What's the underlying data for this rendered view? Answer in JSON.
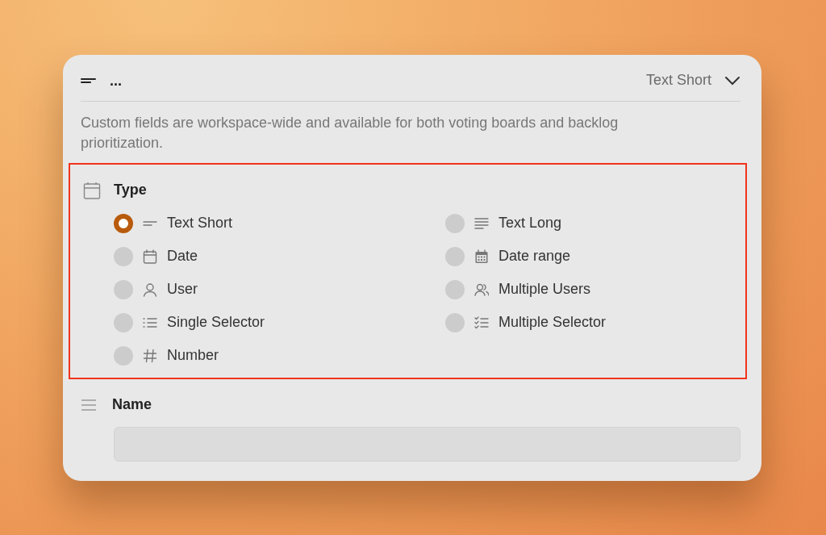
{
  "header": {
    "title": "...",
    "type_select": {
      "value": "Text Short"
    }
  },
  "description": "Custom fields are workspace-wide and available for both voting boards and backlog prioritization.",
  "type_section": {
    "label": "Type",
    "options": [
      {
        "label": "Text Short",
        "kind": "short",
        "selected": true
      },
      {
        "label": "Text Long",
        "kind": "long",
        "selected": false
      },
      {
        "label": "Date",
        "kind": "date",
        "selected": false
      },
      {
        "label": "Date range",
        "kind": "daterange",
        "selected": false
      },
      {
        "label": "User",
        "kind": "user",
        "selected": false
      },
      {
        "label": "Multiple Users",
        "kind": "users",
        "selected": false
      },
      {
        "label": "Single Selector",
        "kind": "list",
        "selected": false
      },
      {
        "label": "Multiple Selector",
        "kind": "checklist",
        "selected": false
      },
      {
        "label": "Number",
        "kind": "number",
        "selected": false
      }
    ]
  },
  "name_section": {
    "label": "Name"
  }
}
